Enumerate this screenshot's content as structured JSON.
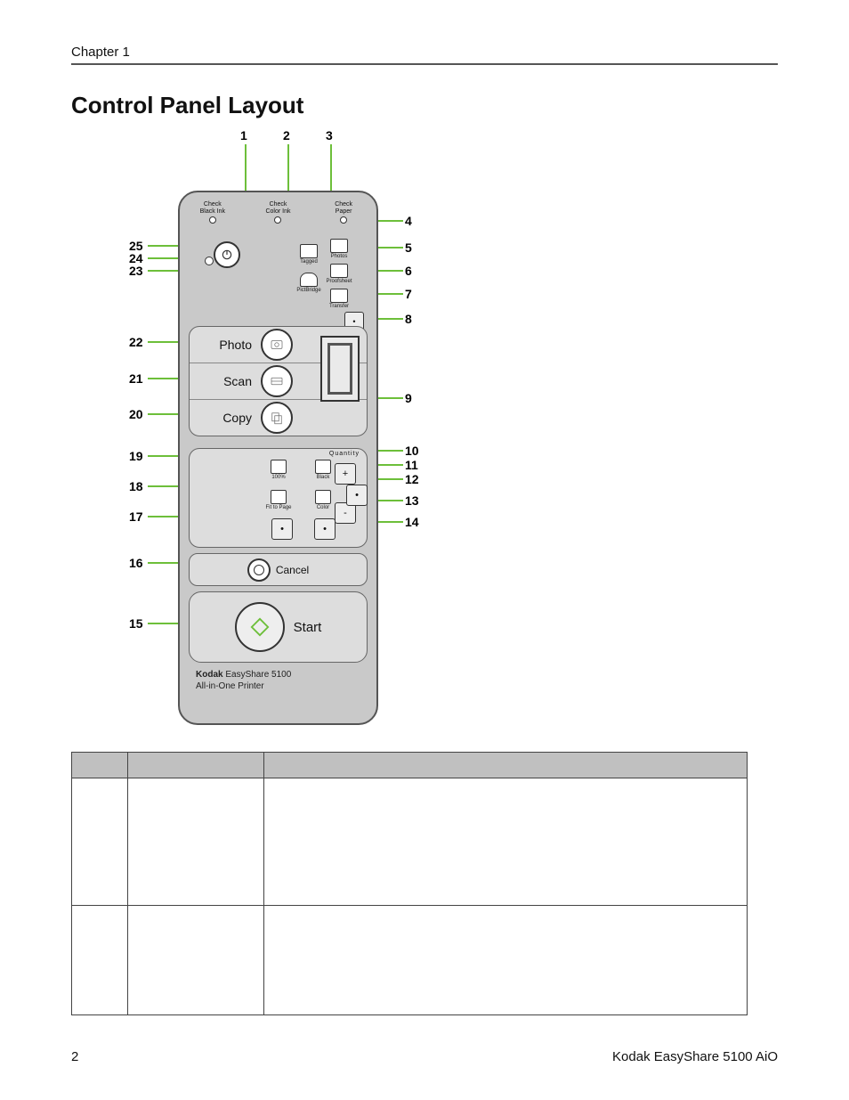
{
  "header": {
    "chapter": "Chapter 1"
  },
  "section": {
    "title": "Control Panel Layout"
  },
  "callouts": {
    "top": {
      "n1": "1",
      "n2": "2",
      "n3": "3"
    },
    "right": {
      "n4": "4",
      "n5": "5",
      "n6": "6",
      "n7": "7",
      "n8": "8",
      "n9": "9",
      "n10": "10",
      "n11": "11",
      "n12": "12",
      "n13": "13",
      "n14": "14"
    },
    "left": {
      "n15": "15",
      "n16": "16",
      "n17": "17",
      "n18": "18",
      "n19": "19",
      "n20": "20",
      "n21": "21",
      "n22": "22",
      "n23": "23",
      "n24": "24",
      "n25": "25"
    }
  },
  "status": {
    "blackInk": "Check\nBlack Ink",
    "colorInk": "Check\nColor Ink",
    "paper": "Check\nPaper"
  },
  "indicators": {
    "tagged": "Tagged",
    "pictbridge": "PictBridge",
    "photos": "Photos",
    "proofsheet": "Proofsheet",
    "transfer": "Transfer"
  },
  "modes": {
    "photo": "Photo",
    "scan": "Scan",
    "copy": "Copy"
  },
  "settings": {
    "quantity_label": "Quantity",
    "hundred": "100%",
    "fitpage": "Fit to Page",
    "black": "Black",
    "color": "Color",
    "plus": "+",
    "minus": "-",
    "dot": "•"
  },
  "cancel": {
    "label": "Cancel"
  },
  "start": {
    "label": "Start"
  },
  "brand": {
    "name": "Kodak",
    "model": " EasyShare 5100",
    "line2": "All-in-One Printer"
  },
  "footer": {
    "page": "2",
    "product": "Kodak EasyShare 5100 AiO"
  }
}
